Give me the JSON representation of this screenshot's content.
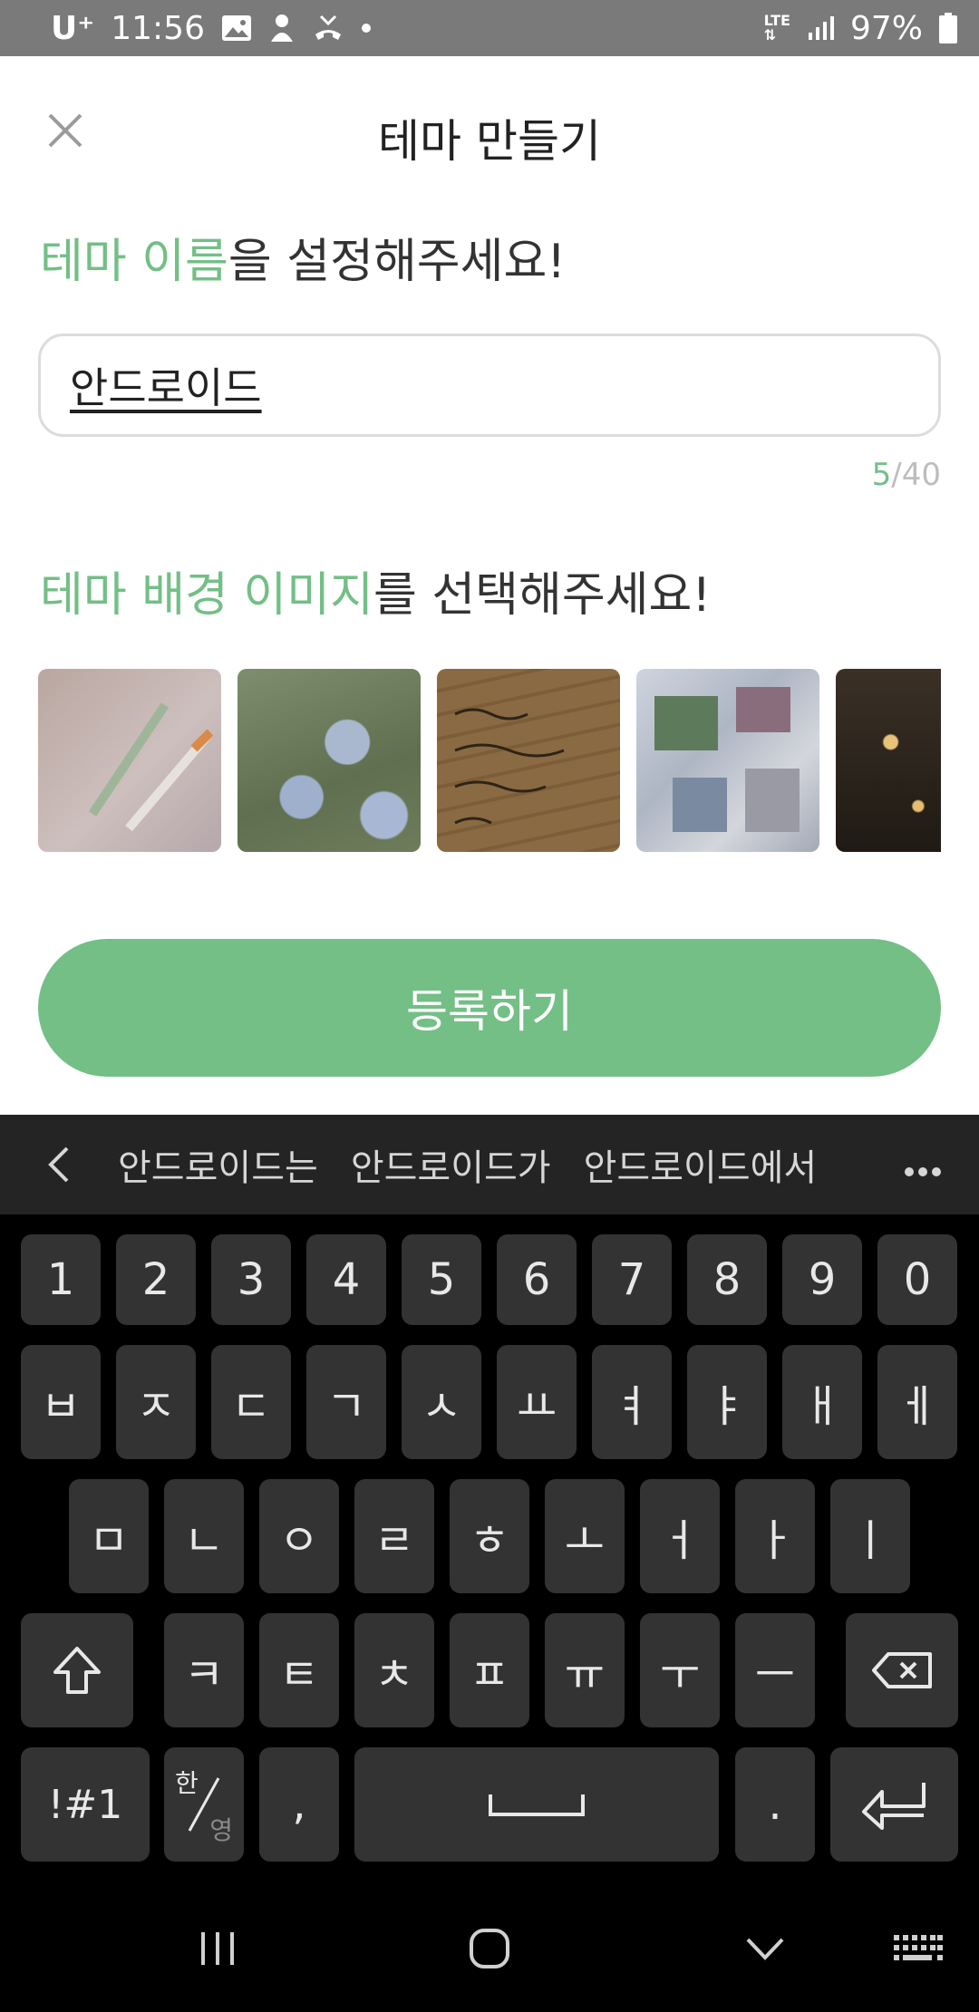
{
  "status_bar": {
    "carrier": "U⁺",
    "time": "11:56",
    "network": "LTE",
    "battery": "97%"
  },
  "header": {
    "title": "테마 만들기"
  },
  "name_section": {
    "title_accent": "테마 이름",
    "title_rest": "을 설정해주세요!",
    "input_value": "안드로이드",
    "count_current": "5",
    "count_max": "/40"
  },
  "image_section": {
    "title_accent": "테마 배경 이미지",
    "title_rest": "를 선택해주세요!"
  },
  "register_button": "등록하기",
  "keyboard": {
    "suggestions": [
      "안드로이드는",
      "안드로이드가",
      "안드로이드에서"
    ],
    "row1": [
      "1",
      "2",
      "3",
      "4",
      "5",
      "6",
      "7",
      "8",
      "9",
      "0"
    ],
    "row2": [
      "ㅂ",
      "ㅈ",
      "ㄷ",
      "ㄱ",
      "ㅅ",
      "ㅛ",
      "ㅕ",
      "ㅑ",
      "ㅐ",
      "ㅔ"
    ],
    "row3": [
      "ㅁ",
      "ㄴ",
      "ㅇ",
      "ㄹ",
      "ㅎ",
      "ㅗ",
      "ㅓ",
      "ㅏ",
      "ㅣ"
    ],
    "row4": [
      "ㅋ",
      "ㅌ",
      "ㅊ",
      "ㅍ",
      "ㅠ",
      "ㅜ",
      "ㅡ"
    ],
    "symbols_key": "!#1",
    "lang_top": "한",
    "lang_bottom": "영",
    "comma_key": ",",
    "period_key": "."
  }
}
